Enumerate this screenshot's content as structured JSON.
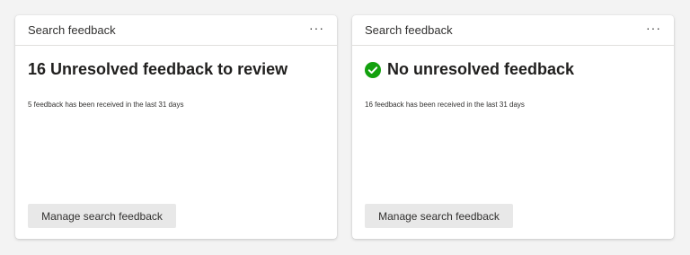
{
  "cards": [
    {
      "title": "Search feedback",
      "more_label": "···",
      "headline": "16 Unresolved feedback to review",
      "subtext": "5 feedback has been received in the last 31 days",
      "button_label": "Manage search feedback"
    },
    {
      "title": "Search feedback",
      "more_label": "···",
      "headline": "No unresolved feedback",
      "status_icon": "check-circle-icon",
      "status_color": "#13a10e",
      "subtext": "16 feedback has been received in the last 31 days",
      "button_label": "Manage search feedback"
    }
  ]
}
